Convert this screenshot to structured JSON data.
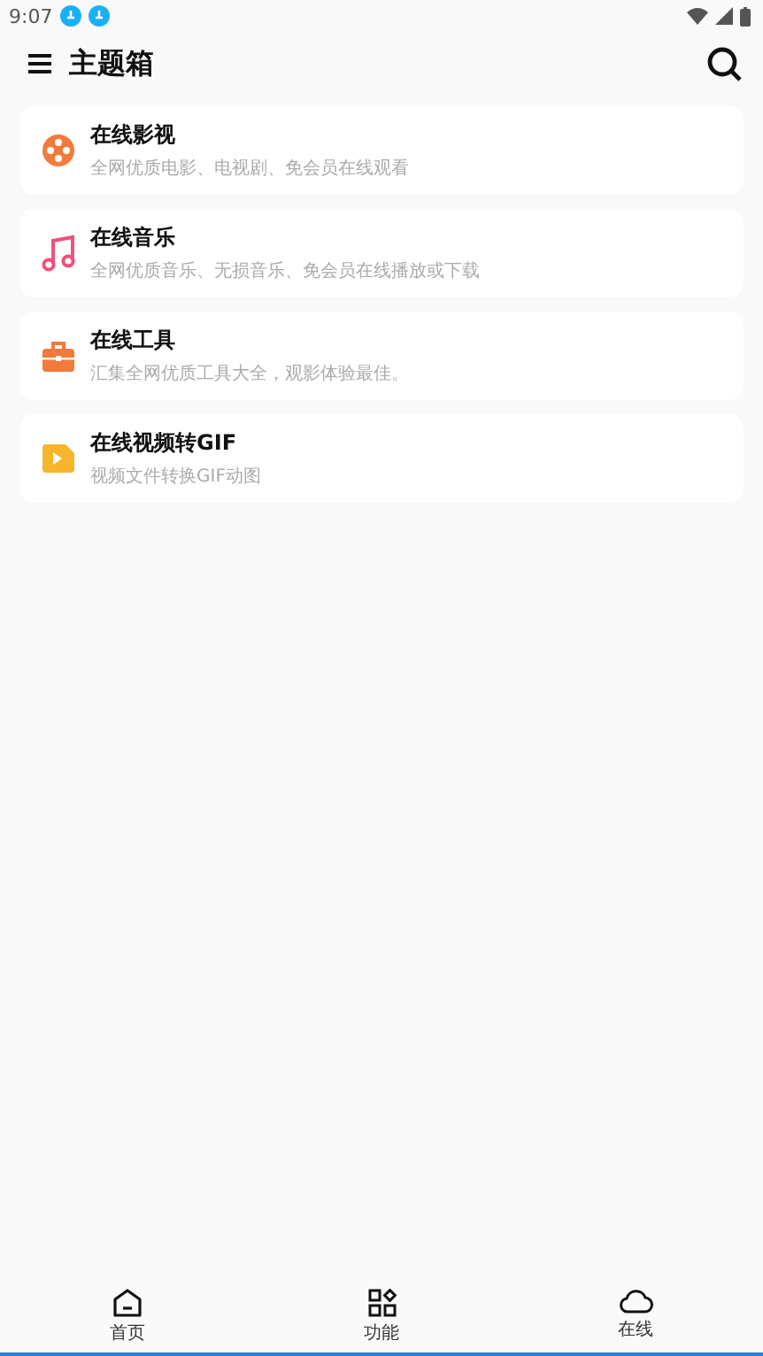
{
  "status_bar": {
    "time": "9:07"
  },
  "header": {
    "title": "主题箱"
  },
  "cards": [
    {
      "kind": "film",
      "title": "在线影视",
      "subtitle": "全网优质电影、电视剧、免会员在线观看"
    },
    {
      "kind": "music",
      "title": "在线音乐",
      "subtitle": "全网优质音乐、无损音乐、免会员在线播放或下载"
    },
    {
      "kind": "toolbox",
      "title": "在线工具",
      "subtitle": "汇集全网优质工具大全，观影体验最佳。"
    },
    {
      "kind": "video",
      "title": "在线视频转GIF",
      "subtitle": "视频文件转换GIF动图"
    }
  ],
  "nav": [
    {
      "kind": "home",
      "label": "首页"
    },
    {
      "kind": "apps",
      "label": "功能"
    },
    {
      "kind": "cloud",
      "label": "在线"
    }
  ]
}
